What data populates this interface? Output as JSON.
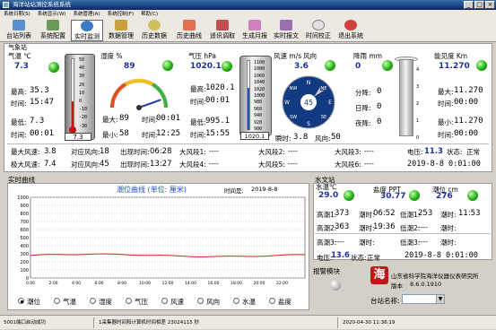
{
  "window": {
    "title": "海洋站站测控系统系统",
    "min": "_",
    "max": "□",
    "close": "×"
  },
  "menu": [
    "系统日期(S)",
    "系统显示(W)",
    "系统管理(A)",
    "系统控制(F)",
    "帮助(C)"
  ],
  "toolbar": [
    "台站列表",
    "系统配置",
    "实时监测",
    "数据管理",
    "历史数据",
    "历史曲线",
    "遥讯调取",
    "生成月报",
    "实时报文",
    "时间校正",
    "退出系统"
  ],
  "station_title": "气象站",
  "temp": {
    "label": "气温 ℃",
    "value": "7.3",
    "max_label": "最高:",
    "max": "35.3",
    "max_time_label": "时间:",
    "max_time": "15:47",
    "min_label": "最低:",
    "min": "7.3",
    "min_time_label": "时间:",
    "min_time": "00:01",
    "thermo_reading": "7.3",
    "scale": [
      "50",
      "40",
      "30",
      "20",
      "10",
      "0",
      "-10",
      "-20",
      "-30"
    ]
  },
  "humidity": {
    "label": "湿度 %",
    "value": "89",
    "max_label": "最大:",
    "max": "89",
    "max_time_label": "时间:",
    "max_time": "00:01",
    "min_label": "最小:",
    "min": "58",
    "min_time_label": "时间:",
    "min_time": "12:25",
    "ticks": [
      "10",
      "20",
      "30",
      "40",
      "50",
      "60",
      "70",
      "80",
      "90",
      "100"
    ]
  },
  "pressure": {
    "label": "气压 hPa",
    "value": "1020.1",
    "max_label": "最高:",
    "max": "1020.1",
    "max_time_label": "时间:",
    "max_time": "00:01",
    "min_label": "最低:",
    "min": "995.1",
    "min_time_label": "时间:",
    "min_time": "15:55",
    "reading": "1020.1",
    "scale": [
      "1100",
      "1080",
      "1060",
      "1040",
      "1020",
      "1000",
      "980",
      "960",
      "940",
      "920",
      "900"
    ]
  },
  "wind": {
    "label": "风速 m/s",
    "dir_label": "风向",
    "speed": "3.6",
    "dir_center": "45",
    "compass": [
      "N",
      "NE",
      "E",
      "SE",
      "S",
      "SW",
      "W",
      "NW"
    ],
    "gust_label": "瞬时:",
    "gust": "3.8",
    "dir_value_label": "风向:",
    "dir_value": "50"
  },
  "rain": {
    "label": "降雨 mm",
    "value": "0",
    "rows": [
      {
        "l": "分降:",
        "v": "0"
      },
      {
        "l": "日降:",
        "v": "0"
      },
      {
        "l": "夜降:",
        "v": "0"
      }
    ],
    "scale": [
      "4",
      "3",
      "2",
      "1",
      "0"
    ]
  },
  "visibility": {
    "label": "能见度 Km",
    "value": "11.270",
    "max_label": "最大:",
    "max": "11.270",
    "max_time_label": "时间:",
    "max_time": "00:00",
    "min_label": "最小:",
    "min": "11.270",
    "min_time_label": "时间:",
    "min_time": "00:00"
  },
  "windstats": [
    {
      "l1": "最大风速:",
      "v1": "3.8",
      "l2": "对应风向:",
      "v2": "18",
      "l3": "出现时间:",
      "v3": "06:28",
      "l4": "大风段1:",
      "v4": "----",
      "l5": "大风段2:",
      "v5": "----",
      "l6": "大风段3:",
      "v6": "----",
      "l7": "电压:",
      "v7": "11.3",
      "l8": "状态:",
      "v8": "正常"
    },
    {
      "l1": "极大风速:",
      "v1": "7.4",
      "l2": "对应风向:",
      "v2": "45",
      "l3": "出现时间:",
      "v3": "13:27",
      "l4": "大风段4:",
      "v4": "----",
      "l5": "大风段5:",
      "v5": "----",
      "l6": "大风段6:",
      "v6": "----",
      "l7": "",
      "v7": "2019-8-8 0:01:00",
      "l8": "",
      "v8": ""
    }
  ],
  "curve": {
    "section": "实时曲线",
    "title": "潮位曲线 (单位: 厘米)",
    "time_label": "时间是:",
    "time_value": "2019-8-8",
    "y_labels": [
      "1000",
      "900",
      "800",
      "700",
      "600",
      "500",
      "400",
      "300",
      "200",
      "100",
      "0"
    ],
    "x_labels": [
      "0:00",
      "2:00",
      "4:00",
      "6:00",
      "8:00",
      "10:00",
      "12:00",
      "14:00",
      "16:00",
      "18:00",
      "20:00",
      "22:00"
    ],
    "radios": [
      "潮位",
      "气温",
      "湿度",
      "气压",
      "风速",
      "风向",
      "水温",
      "盐度"
    ],
    "selected": 0
  },
  "hydro": {
    "section": "水文站",
    "wtemp_label": "水温℃",
    "wtemp": "29.0",
    "salinity_label": "盐度 PPT",
    "salinity": "30.77",
    "tide_label": "潮位 cm",
    "tide": "276",
    "rows": [
      [
        {
          "l": "高潮1:",
          "v": "373"
        },
        {
          "l": "潮时:",
          "v": "06:52"
        },
        {
          "l": "低潮1:",
          "v": "253"
        },
        {
          "l": "潮时:",
          "v": "11:53"
        }
      ],
      [
        {
          "l": "高潮2:",
          "v": "363"
        },
        {
          "l": "潮时:",
          "v": "19:36"
        },
        {
          "l": "低潮2:",
          "v": "----"
        },
        {
          "l": "潮时:",
          "v": ""
        }
      ],
      [
        {
          "l": "高潮3:",
          "v": "----"
        },
        {
          "l": "潮时:",
          "v": ""
        },
        {
          "l": "低潮3:",
          "v": "----"
        },
        {
          "l": "潮时:",
          "v": ""
        }
      ]
    ],
    "voltage_label": "电压:",
    "voltage": "13.6",
    "state_label": "状态:",
    "state": "正常",
    "time": "2019-8-8 0:01:00"
  },
  "alarm": {
    "label": "报警模块"
  },
  "org": {
    "logo": "海",
    "name": "山东省科学院海洋仪器仪表研究所",
    "version_label": "版本",
    "version": "8.6.0.1910",
    "station_label": "台站名称:",
    "station_value": ""
  },
  "status": {
    "port": "5001端口启动成功",
    "info": "1采集器时间和计算机时间相差  23024115 秒",
    "datetime": "2020-04-30  11:36:19"
  }
}
